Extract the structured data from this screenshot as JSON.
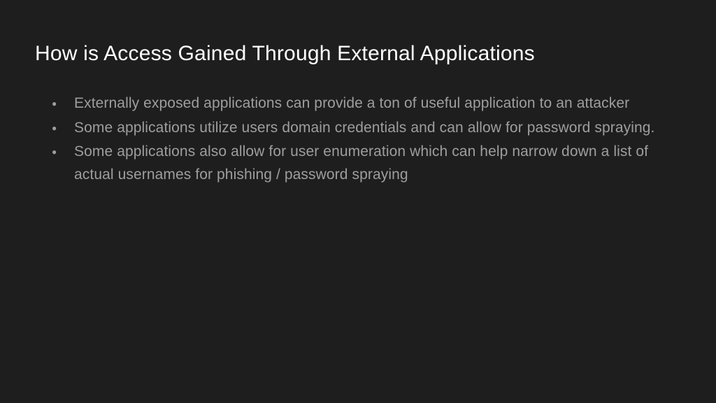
{
  "slide": {
    "title": "How is Access Gained Through External Applications",
    "bullets": [
      "Externally exposed applications can provide a ton of useful application to an attacker",
      "Some applications utilize users domain credentials and can allow for password spraying.",
      "Some applications also allow for user enumeration which can help narrow down a list of actual usernames for phishing / password spraying"
    ]
  }
}
